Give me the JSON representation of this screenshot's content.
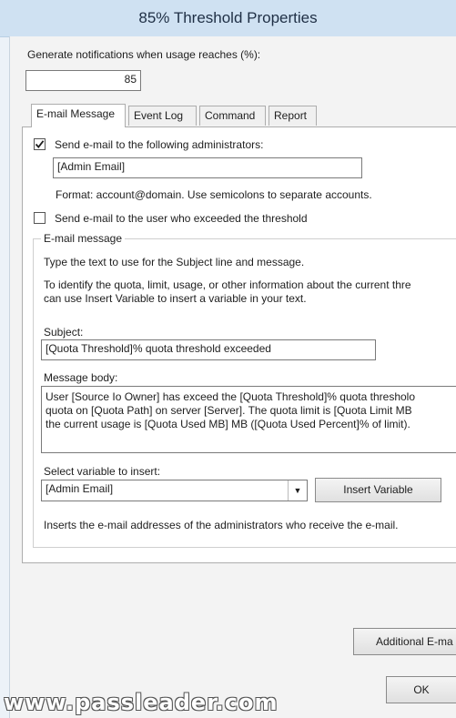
{
  "window": {
    "title": "85% Threshold Properties"
  },
  "threshold": {
    "label": "Generate notifications when usage reaches (%):",
    "value": "85"
  },
  "tabs": [
    {
      "label": "E-mail Message"
    },
    {
      "label": "Event Log"
    },
    {
      "label": "Command"
    },
    {
      "label": "Report"
    }
  ],
  "email": {
    "admin_check_label": "Send e-mail to the following administrators:",
    "admin_checked": true,
    "admin_value": "[Admin Email]",
    "format_note": "Format: account@domain. Use semicolons to separate accounts.",
    "user_check_label": "Send e-mail to the user who exceeded the threshold",
    "user_checked": false,
    "group_label": "E-mail message",
    "instr1": "Type the text to use for the Subject line and message.",
    "instr2_line1": "To identify the quota, limit, usage, or other information about the current thre",
    "instr2_line2": "can use Insert Variable to insert a variable in your text.",
    "subject_label": "Subject:",
    "subject_value": "[Quota Threshold]% quota threshold exceeded",
    "body_label": "Message body:",
    "body_line1": "User [Source Io Owner] has exceed the [Quota Threshold]% quota thresholo",
    "body_line2": "quota on [Quota Path] on server [Server]. The quota limit is [Quota Limit MB",
    "body_line3": "the current usage is [Quota Used MB] MB ([Quota Used Percent]% of limit).",
    "variable_label": "Select variable to insert:",
    "variable_value": "[Admin Email]",
    "insert_button": "Insert Variable",
    "variable_desc": "Inserts the e-mail addresses of the administrators who receive the e-mail."
  },
  "buttons": {
    "additional": "Additional E-ma",
    "ok": "OK"
  },
  "watermark": "www.passleader.com"
}
